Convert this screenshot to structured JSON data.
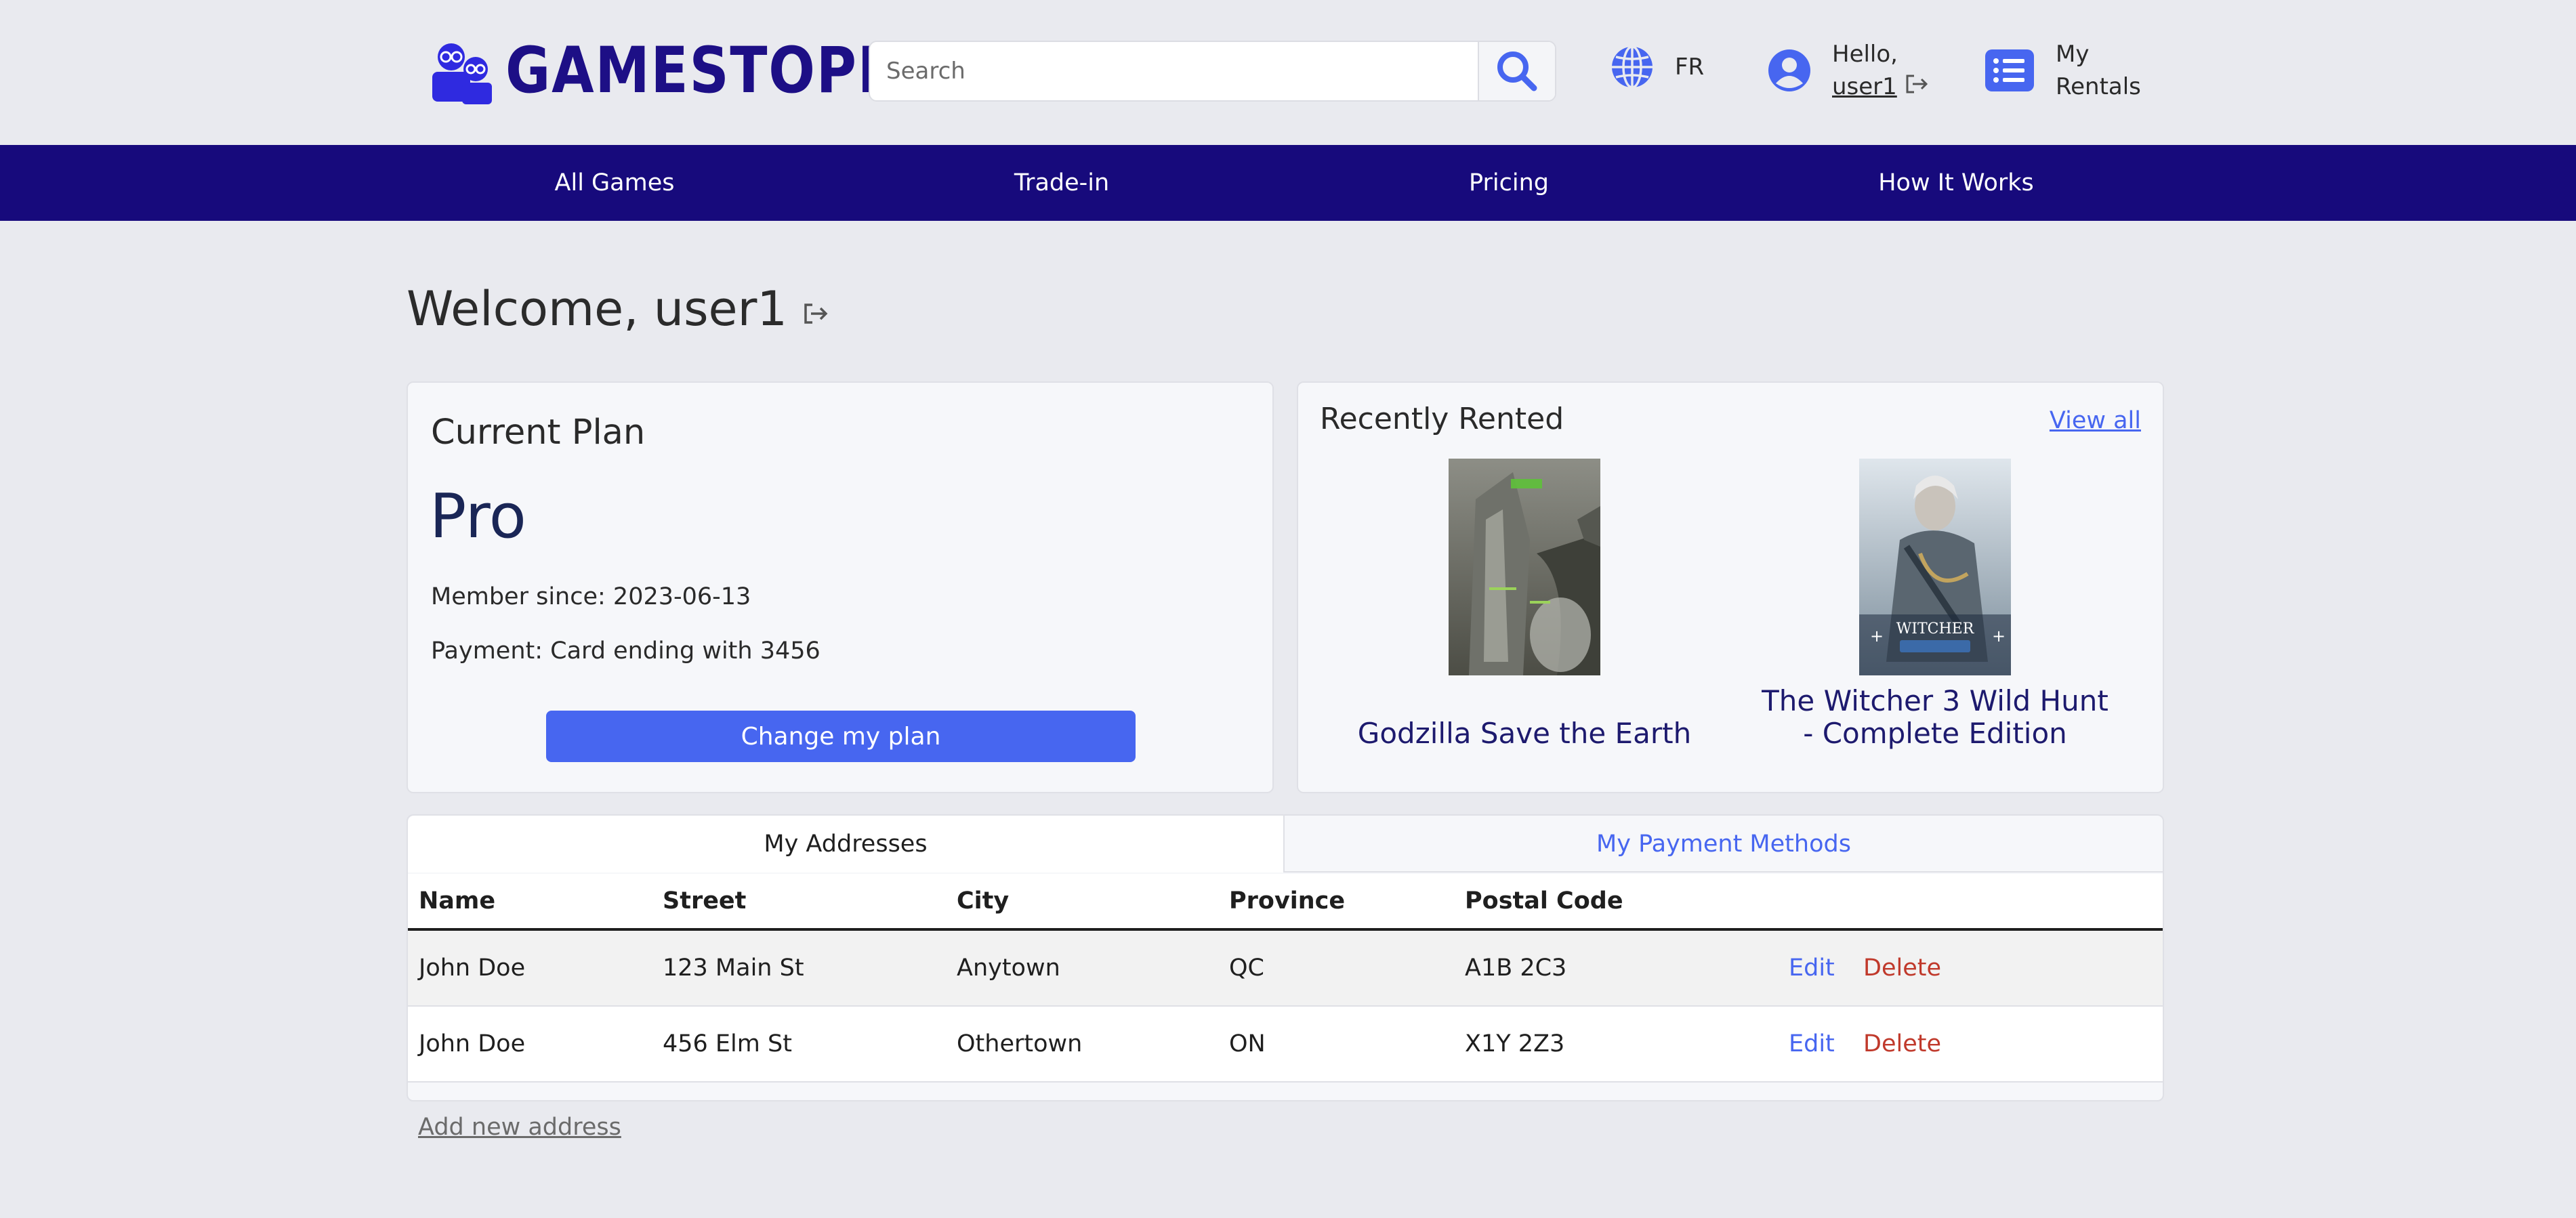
{
  "header": {
    "brand": "GAMESTOPIA",
    "search_placeholder": "Search",
    "language": "FR",
    "greeting": "Hello,",
    "username": "user1",
    "rentals_line1": "My",
    "rentals_line2": "Rentals"
  },
  "nav": {
    "items": [
      "All Games",
      "Trade-in",
      "Pricing",
      "How It Works"
    ]
  },
  "welcome": "Welcome, user1",
  "plan": {
    "title": "Current Plan",
    "name": "Pro",
    "member_since": "Member since: 2023-06-13",
    "payment": "Payment: Card ending with 3456",
    "button": "Change my plan"
  },
  "recent": {
    "title": "Recently Rented",
    "view_all": "View all",
    "games": [
      {
        "title": "Godzilla Save the Earth"
      },
      {
        "title": "The Witcher 3 Wild Hunt - Complete Edition"
      }
    ]
  },
  "tabs": {
    "addresses": "My Addresses",
    "payments": "My Payment Methods"
  },
  "table": {
    "headers": [
      "Name",
      "Street",
      "City",
      "Province",
      "Postal Code"
    ],
    "rows": [
      {
        "name": "John Doe",
        "street": "123 Main St",
        "city": "Anytown",
        "province": "QC",
        "postal": "A1B 2C3",
        "edit": "Edit",
        "delete": "Delete"
      },
      {
        "name": "John Doe",
        "street": "456 Elm St",
        "city": "Othertown",
        "province": "ON",
        "postal": "X1Y 2Z3",
        "edit": "Edit",
        "delete": "Delete"
      }
    ]
  },
  "add_address": "Add new address",
  "colors": {
    "brand": "#1d0f86",
    "nav": "#170a7c",
    "accent": "#4766f0",
    "danger": "#c0392b"
  }
}
